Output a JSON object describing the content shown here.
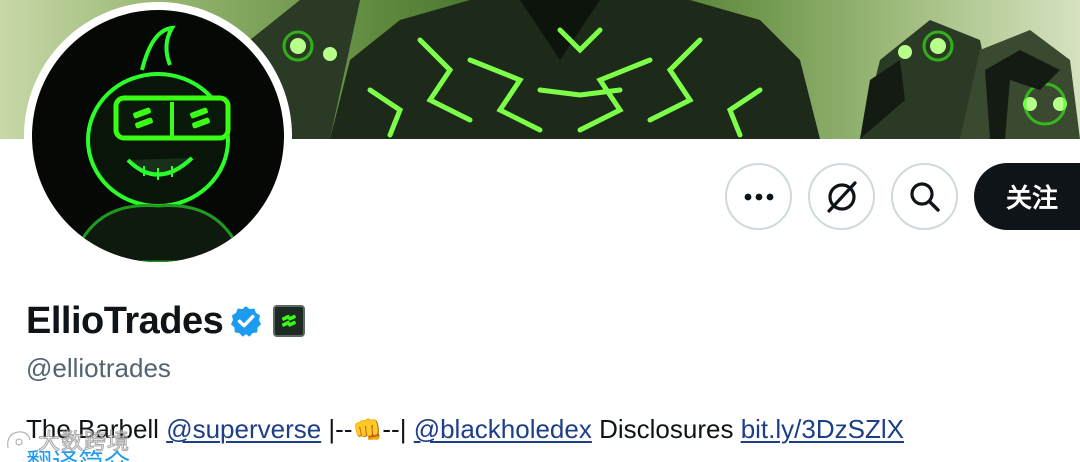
{
  "profile": {
    "display_name": "EllioTrades",
    "handle": "@elliotrades",
    "follow_label": "关注",
    "translate_label": "翻译简介"
  },
  "bio": {
    "text_1": "The Barbell ",
    "mention_1": "@superverse",
    "text_2": " |--",
    "emoji": "👊",
    "text_3": "--| ",
    "mention_2": "@blackholedex",
    "text_4": " Disclosures ",
    "link": "bit.ly/3DzSZlX"
  },
  "watermark": {
    "text": "大数跨境"
  },
  "icons": {
    "more": "more-dots-icon",
    "grok": "grok-icon",
    "search": "search-icon",
    "verified": "verified-badge-icon",
    "affiliate": "affiliate-badge-icon"
  },
  "colors": {
    "verified": "#1d9bf0",
    "link": "#1d3f87",
    "follow_button": "#0f1419",
    "neon_green": "#39ff14"
  }
}
